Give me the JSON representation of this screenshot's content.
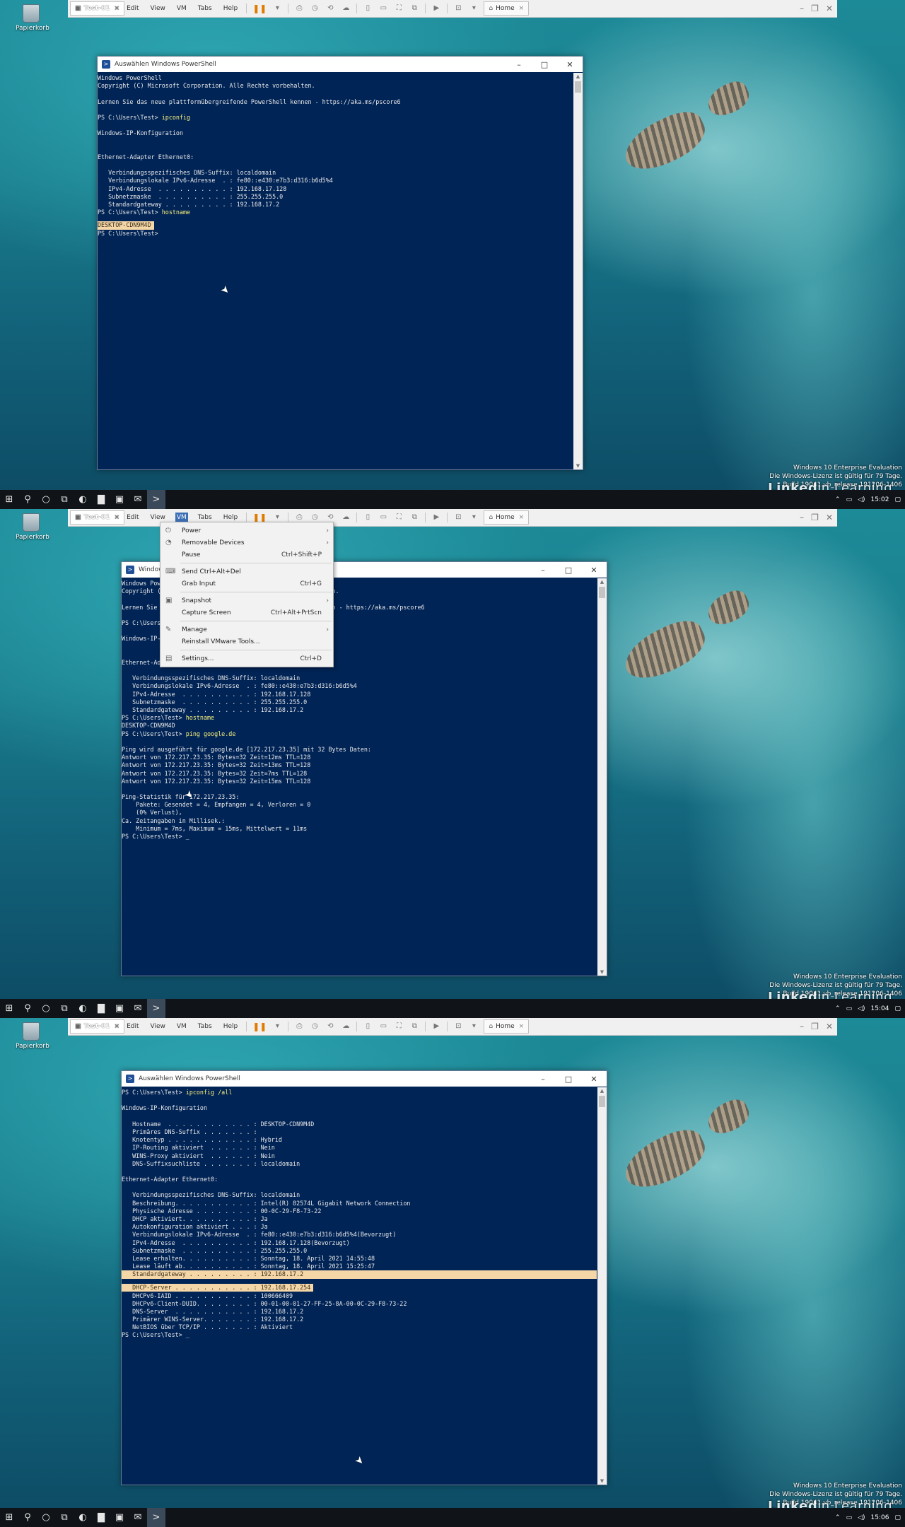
{
  "desktop": {
    "recycle_bin_label": "Papierkorb"
  },
  "vmware": {
    "menu": [
      "File",
      "Edit",
      "View",
      "VM",
      "Tabs",
      "Help"
    ],
    "tabs": [
      {
        "label": "Home"
      },
      {
        "label": "Test-01"
      }
    ]
  },
  "watermark": {
    "line1": "Windows 10 Enterprise Evaluation",
    "line2": "Die Windows-Lizenz ist gültig für 79 Tage.",
    "build": "Build 19041.vb_release.191206-1406"
  },
  "linkedin": {
    "brand": "Linked",
    "suffix": "in Learning"
  },
  "frames": [
    {
      "window_title": "Auswählen Windows PowerShell",
      "clock": "15:02",
      "lines": [
        {
          "t": "Windows PowerShell"
        },
        {
          "t": "Copyright (C) Microsoft Corporation. Alle Rechte vorbehalten."
        },
        {
          "t": ""
        },
        {
          "t": "Lernen Sie das neue plattformübergreifende PowerShell kennen - https://aka.ms/pscore6"
        },
        {
          "t": ""
        },
        {
          "p": "PS C:\\Users\\Test> ",
          "c": "ipconfig"
        },
        {
          "t": ""
        },
        {
          "t": "Windows-IP-Konfiguration"
        },
        {
          "t": ""
        },
        {
          "t": ""
        },
        {
          "t": "Ethernet-Adapter Ethernet0:"
        },
        {
          "t": ""
        },
        {
          "t": "   Verbindungsspezifisches DNS-Suffix: localdomain"
        },
        {
          "t": "   Verbindungslokale IPv6-Adresse  . : fe80::e430:e7b3:d316:b6d5%4"
        },
        {
          "t": "   IPv4-Adresse  . . . . . . . . . . : 192.168.17.128"
        },
        {
          "t": "   Subnetzmaske  . . . . . . . . . . : 255.255.255.0"
        },
        {
          "t": "   Standardgateway . . . . . . . . . : 192.168.17.2"
        },
        {
          "p": "PS C:\\Users\\Test> ",
          "c": "hostname"
        },
        {
          "t": "DESKTOP-CDN9M4D",
          "h": "line"
        },
        {
          "t": "PS C:\\Users\\Test>"
        }
      ]
    },
    {
      "window_title": "Windows PowerShell",
      "clock": "15:04",
      "vm_menu": [
        {
          "label": "Power",
          "sc": "",
          "arrow": true,
          "icon": "power-icon",
          "glyph": "⏻"
        },
        {
          "label": "Removable Devices",
          "sc": "",
          "arrow": true,
          "icon": "devices-icon",
          "glyph": "◔"
        },
        {
          "label": "Pause",
          "sc": "Ctrl+Shift+P",
          "arrow": false,
          "icon": "",
          "glyph": ""
        },
        {
          "sep": true
        },
        {
          "label": "Send Ctrl+Alt+Del",
          "sc": "",
          "arrow": false,
          "icon": "keyboard-icon",
          "glyph": "⌨"
        },
        {
          "label": "Grab Input",
          "sc": "Ctrl+G",
          "arrow": false,
          "icon": "",
          "glyph": ""
        },
        {
          "sep": true
        },
        {
          "label": "Snapshot",
          "sc": "",
          "arrow": true,
          "icon": "snapshot-icon",
          "glyph": "▣"
        },
        {
          "label": "Capture Screen",
          "sc": "Ctrl+Alt+PrtScn",
          "arrow": false,
          "icon": "",
          "glyph": ""
        },
        {
          "sep": true
        },
        {
          "label": "Manage",
          "sc": "",
          "arrow": true,
          "icon": "wrench-icon",
          "glyph": "✎"
        },
        {
          "label": "Reinstall VMware Tools...",
          "sc": "",
          "arrow": false,
          "icon": "",
          "glyph": ""
        },
        {
          "sep": true
        },
        {
          "label": "Settings...",
          "sc": "Ctrl+D",
          "arrow": false,
          "icon": "settings-icon",
          "glyph": "▤"
        }
      ],
      "lines": [
        {
          "t": "Windows PowerShell"
        },
        {
          "t": "Copyright (C) Microsoft Corporation. Alle Rechte vorbehalten."
        },
        {
          "t": ""
        },
        {
          "t": "Lernen Sie das neue plattformübergreifende PowerShell kennen - https://aka.ms/pscore6"
        },
        {
          "t": ""
        },
        {
          "p": "PS C:\\Users\\Test> ",
          "c": "ipconfig"
        },
        {
          "t": ""
        },
        {
          "t": "Windows-IP-Konfiguration"
        },
        {
          "t": ""
        },
        {
          "t": ""
        },
        {
          "t": "Ethernet-Adapter Ethernet0:"
        },
        {
          "t": ""
        },
        {
          "t": "   Verbindungsspezifisches DNS-Suffix: localdomain"
        },
        {
          "t": "   Verbindungslokale IPv6-Adresse  . : fe80::e430:e7b3:d316:b6d5%4"
        },
        {
          "t": "   IPv4-Adresse  . . . . . . . . . . : 192.168.17.128"
        },
        {
          "t": "   Subnetzmaske  . . . . . . . . . . : 255.255.255.0"
        },
        {
          "t": "   Standardgateway . . . . . . . . . : 192.168.17.2"
        },
        {
          "p": "PS C:\\Users\\Test> ",
          "c": "hostname"
        },
        {
          "t": "DESKTOP-CDN9M4D"
        },
        {
          "p": "PS C:\\Users\\Test> ",
          "c": "ping google.de"
        },
        {
          "t": ""
        },
        {
          "t": "Ping wird ausgeführt für google.de [172.217.23.35] mit 32 Bytes Daten:"
        },
        {
          "t": "Antwort von 172.217.23.35: Bytes=32 Zeit=12ms TTL=128"
        },
        {
          "t": "Antwort von 172.217.23.35: Bytes=32 Zeit=13ms TTL=128"
        },
        {
          "t": "Antwort von 172.217.23.35: Bytes=32 Zeit=7ms TTL=128"
        },
        {
          "t": "Antwort von 172.217.23.35: Bytes=32 Zeit=15ms TTL=128"
        },
        {
          "t": ""
        },
        {
          "t": "Ping-Statistik für 172.217.23.35:"
        },
        {
          "t": "    Pakete: Gesendet = 4, Empfangen = 4, Verloren = 0"
        },
        {
          "t": "    (0% Verlust),"
        },
        {
          "t": "Ca. Zeitangaben in Millisek.:"
        },
        {
          "t": "    Minimum = 7ms, Maximum = 15ms, Mittelwert = 11ms"
        },
        {
          "t": "PS C:\\Users\\Test> _"
        }
      ]
    },
    {
      "window_title": "Auswählen Windows PowerShell",
      "clock": "15:06",
      "lines": [
        {
          "p": "PS C:\\Users\\Test> ",
          "c": "ipconfig /all"
        },
        {
          "t": ""
        },
        {
          "t": "Windows-IP-Konfiguration"
        },
        {
          "t": ""
        },
        {
          "t": "   Hostname  . . . . . . . . . . . . : DESKTOP-CDN9M4D"
        },
        {
          "t": "   Primäres DNS-Suffix . . . . . . . :"
        },
        {
          "t": "   Knotentyp . . . . . . . . . . . . : Hybrid"
        },
        {
          "t": "   IP-Routing aktiviert  . . . . . . : Nein"
        },
        {
          "t": "   WINS-Proxy aktiviert  . . . . . . : Nein"
        },
        {
          "t": "   DNS-Suffixsuchliste . . . . . . . : localdomain"
        },
        {
          "t": ""
        },
        {
          "t": "Ethernet-Adapter Ethernet0:"
        },
        {
          "t": ""
        },
        {
          "t": "   Verbindungsspezifisches DNS-Suffix: localdomain"
        },
        {
          "t": "   Beschreibung. . . . . . . . . . . : Intel(R) 82574L Gigabit Network Connection"
        },
        {
          "t": "   Physische Adresse . . . . . . . . : 00-0C-29-F8-73-22"
        },
        {
          "t": "   DHCP aktiviert. . . . . . . . . . : Ja"
        },
        {
          "t": "   Autokonfiguration aktiviert . . . : Ja"
        },
        {
          "t": "   Verbindungslokale IPv6-Adresse  . : fe80::e430:e7b3:d316:b6d5%4(Bevorzugt)"
        },
        {
          "t": "   IPv4-Adresse  . . . . . . . . . . : 192.168.17.128(Bevorzugt)"
        },
        {
          "t": "   Subnetzmaske  . . . . . . . . . . : 255.255.255.0"
        },
        {
          "t": "   Lease erhalten. . . . . . . . . . : Sonntag, 18. April 2021 14:55:48"
        },
        {
          "t": "   Lease läuft ab. . . . . . . . . . : Sonntag, 18. April 2021 15:25:47"
        },
        {
          "t": "   Standardgateway . . . . . . . . . : 192.168.17.2",
          "h": "full"
        },
        {
          "t": "   DHCP-Server . . . . . . . . . . . : 192.168.17.254",
          "h": "line"
        },
        {
          "t": "   DHCPv6-IAID . . . . . . . . . . . : 100666409"
        },
        {
          "t": "   DHCPv6-Client-DUID. . . . . . . . : 00-01-00-01-27-FF-25-8A-00-0C-29-F8-73-22"
        },
        {
          "t": "   DNS-Server  . . . . . . . . . . . : 192.168.17.2"
        },
        {
          "t": "   Primärer WINS-Server. . . . . . . : 192.168.17.2"
        },
        {
          "t": "   NetBIOS über TCP/IP . . . . . . . : Aktiviert"
        },
        {
          "t": "PS C:\\Users\\Test> _"
        }
      ]
    }
  ]
}
